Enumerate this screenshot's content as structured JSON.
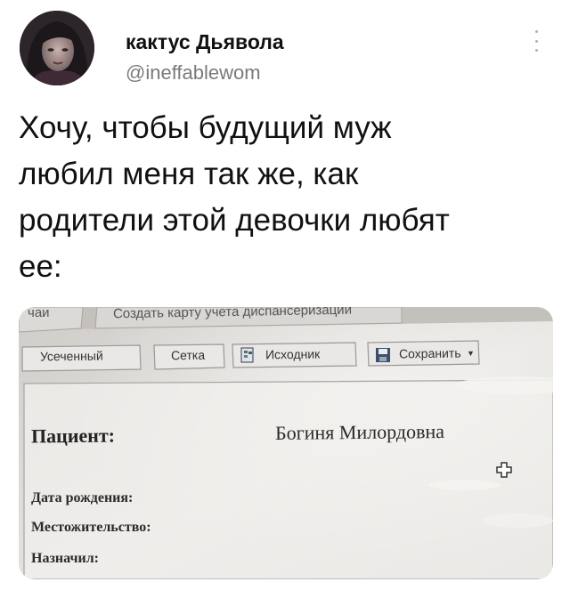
{
  "tweet": {
    "author_name": "кактус Дьявола",
    "author_handle": "@ineffablewom",
    "text": "Хочу, чтобы будущий муж\nлюбил меня так же, как\nродители этой девочки любят\nее:"
  },
  "photo": {
    "tab_partial": "чаи",
    "tab_create_card": "Создать карту учета диспансеризации",
    "toolbar": {
      "truncated": "Усеченный",
      "grid": "Сетка",
      "source": "Исходник",
      "save": "Сохранить"
    },
    "form": {
      "patient_label": "Пациент:",
      "patient_value": "Богиня Милордовна",
      "birth_date_label": "Дата рождения:",
      "residence_label": "Местожительство:",
      "prescribed_label": "Назначил:"
    }
  },
  "colors": {
    "text": "#111111",
    "handle": "#7a7a7a",
    "background": "#ffffff"
  },
  "icons": [
    "avatar",
    "more-options-icon",
    "source-doc-icon",
    "floppy-save-icon",
    "medical-cross-icon"
  ]
}
